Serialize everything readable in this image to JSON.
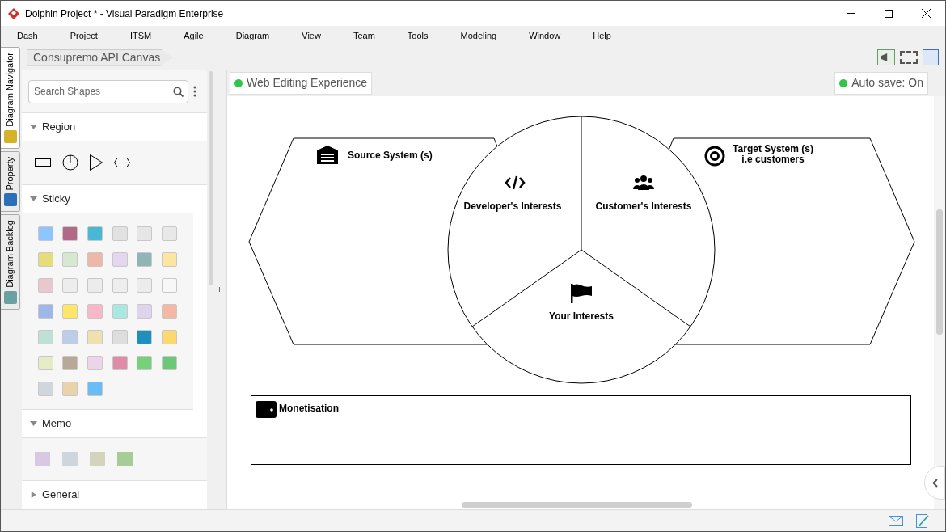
{
  "window": {
    "title": "Dolphin Project * - Visual Paradigm Enterprise"
  },
  "menu": [
    "Dash",
    "Project",
    "ITSM",
    "Agile",
    "Diagram",
    "View",
    "Team",
    "Tools",
    "Modeling",
    "Window",
    "Help"
  ],
  "side_tabs": [
    {
      "label": "Diagram Navigator",
      "selected": true
    },
    {
      "label": "Property",
      "selected": false
    },
    {
      "label": "Diagram Backlog",
      "selected": false
    }
  ],
  "breadcrumb": "Consupremo API Canvas",
  "palette": {
    "search": {
      "placeholder": "Search Shapes"
    },
    "sections": [
      {
        "title": "Region",
        "expanded": true,
        "kind": "region"
      },
      {
        "title": "Sticky",
        "expanded": true,
        "kind": "sticky"
      },
      {
        "title": "Memo",
        "expanded": true,
        "kind": "memo"
      },
      {
        "title": "General",
        "expanded": false
      }
    ]
  },
  "canvas": {
    "mode_badge": "Web Editing Experience",
    "autosave": "Auto save: On",
    "diagram": {
      "source": "Source System (s)",
      "target": [
        "Target System (s)",
        "i.e customers"
      ],
      "developer": "Developer's Interests",
      "customer": "Customer's Interests",
      "yours": "Your Interests",
      "monetisation": "Monetisation"
    }
  }
}
